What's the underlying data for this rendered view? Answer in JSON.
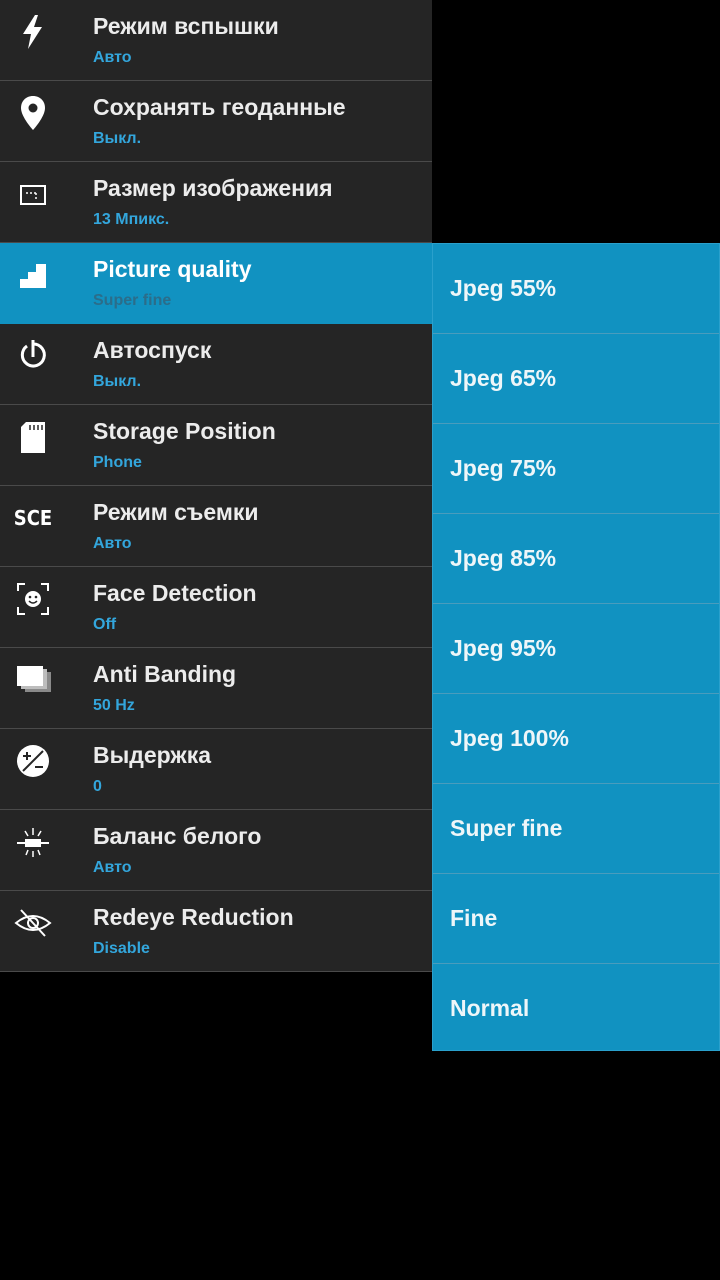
{
  "settings": [
    {
      "icon": "flash-icon",
      "title": "Режим вспышки",
      "value": "Авто"
    },
    {
      "icon": "location-pin-icon",
      "title": "Сохранять геоданные",
      "value": "Выкл."
    },
    {
      "icon": "image-size-icon",
      "title": "Размер изображения",
      "value": "13 Мпикс."
    },
    {
      "icon": "picture-quality-icon",
      "title": "Picture quality",
      "value": "Super fine",
      "selected": true
    },
    {
      "icon": "self-timer-icon",
      "title": "Автоспуск",
      "value": "Выкл."
    },
    {
      "icon": "sd-card-icon",
      "title": "Storage Position",
      "value": "Phone"
    },
    {
      "icon": "scene-mode-icon",
      "icon_text": "SCE",
      "title": "Режим съемки",
      "value": "Авто"
    },
    {
      "icon": "face-detection-icon",
      "title": "Face Detection",
      "value": "Off"
    },
    {
      "icon": "anti-banding-icon",
      "title": "Anti Banding",
      "value": "50 Hz"
    },
    {
      "icon": "exposure-icon",
      "title": "Выдержка",
      "value": "0"
    },
    {
      "icon": "white-balance-icon",
      "title": "Баланс белого",
      "value": "Авто"
    },
    {
      "icon": "redeye-icon",
      "title": "Redeye Reduction",
      "value": "Disable"
    }
  ],
  "quality_options": [
    "Jpeg 55%",
    "Jpeg 65%",
    "Jpeg 75%",
    "Jpeg 85%",
    "Jpeg 95%",
    "Jpeg 100%",
    "Super fine",
    "Fine",
    "Normal"
  ],
  "colors": {
    "accent": "#1192c1",
    "row_background": "#252525",
    "value_text": "#33a6dc"
  }
}
